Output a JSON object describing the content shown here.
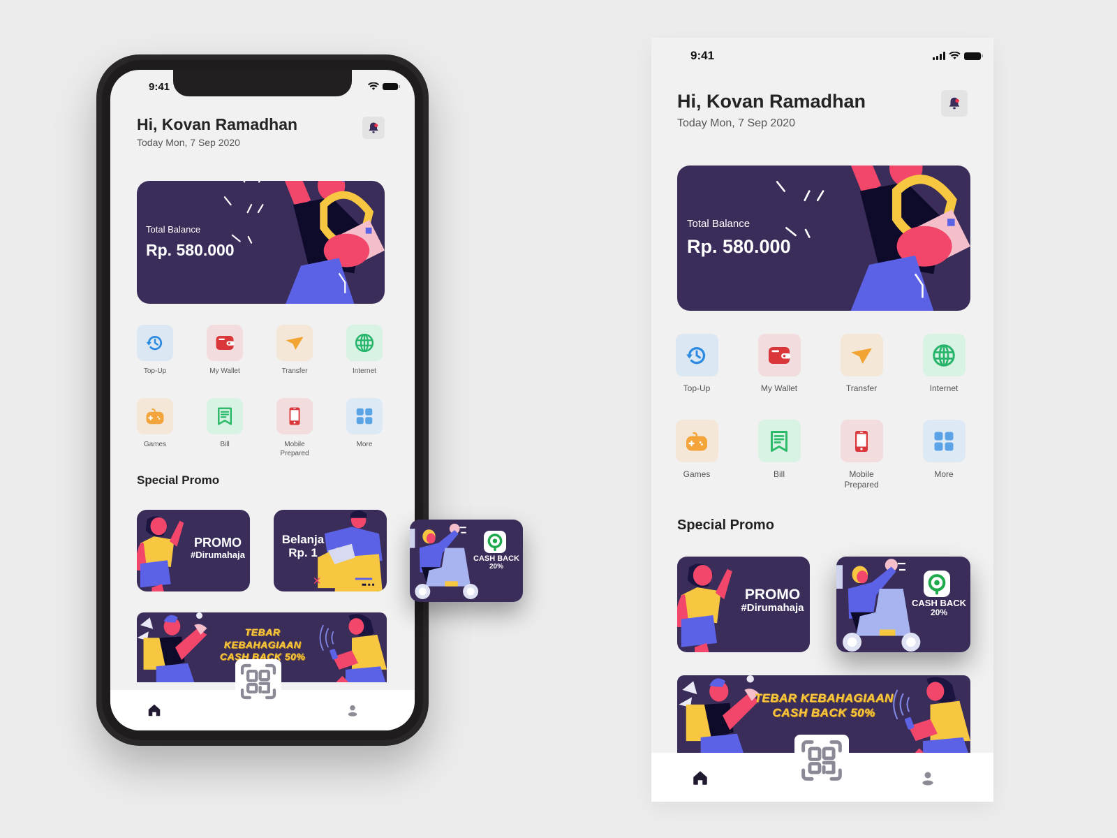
{
  "status_bar": {
    "time": "9:41"
  },
  "header": {
    "greeting": "Hi, Kovan Ramadhan",
    "date": "Today Mon, 7 Sep 2020",
    "notification_icon": "bell-icon"
  },
  "balance_card": {
    "label": "Total Balance",
    "value": "Rp. 580.000"
  },
  "menu": [
    {
      "label": "Top-Up",
      "icon": "history-icon",
      "tile_color": "#dbe7f3",
      "icon_color": "#2c8be0"
    },
    {
      "label": "My Wallet",
      "icon": "wallet-icon",
      "tile_color": "#f3dcdd",
      "icon_color": "#d9373a"
    },
    {
      "label": "Transfer",
      "icon": "paper-plane-icon",
      "tile_color": "#f4e7d8",
      "icon_color": "#f1a431"
    },
    {
      "label": "Internet",
      "icon": "globe-icon",
      "tile_color": "#d8f2e4",
      "icon_color": "#27b56c"
    },
    {
      "label": "Games",
      "icon": "gamepad-icon",
      "tile_color": "#f4e7d8",
      "icon_color": "#f3a43a"
    },
    {
      "label": "Bill",
      "icon": "receipt-icon",
      "tile_color": "#d8f2e4",
      "icon_color": "#2dbb6a"
    },
    {
      "label": "Mobile\nPrepared",
      "label_line1": "Mobile",
      "label_line2": "Prepared",
      "icon": "smartphone-icon",
      "tile_color": "#f3dcdd",
      "icon_color": "#d9373a"
    },
    {
      "label": "More",
      "icon": "grid-icon",
      "tile_color": "#dde9f4",
      "icon_color": "#5aa4e6"
    }
  ],
  "special_promo": {
    "title": "Special Promo",
    "cards": [
      {
        "line1": "PROMO",
        "line2": "#Dirumahaja"
      },
      {
        "line1": "Belanja",
        "line2": "Rp. 1"
      },
      {
        "line1": "CASH BACK",
        "line2": "20%"
      }
    ],
    "banner": {
      "line1": "TEBAR KEBAHAGIAAN",
      "line2": "CASH BACK 50%"
    }
  },
  "tab_bar": {
    "items": [
      {
        "name": "home",
        "icon": "home-icon",
        "active": true
      },
      {
        "name": "scan",
        "icon": "qr-code-icon",
        "active": false
      },
      {
        "name": "profile",
        "icon": "user-icon",
        "active": false
      }
    ]
  },
  "colors": {
    "brand_dark": "#3b2d5a",
    "accent_yellow": "#f7c741",
    "accent_pink": "#f2476a",
    "accent_blue": "#5b62e6",
    "screen_bg": "#f1f1f1",
    "page_bg": "#ececec"
  }
}
